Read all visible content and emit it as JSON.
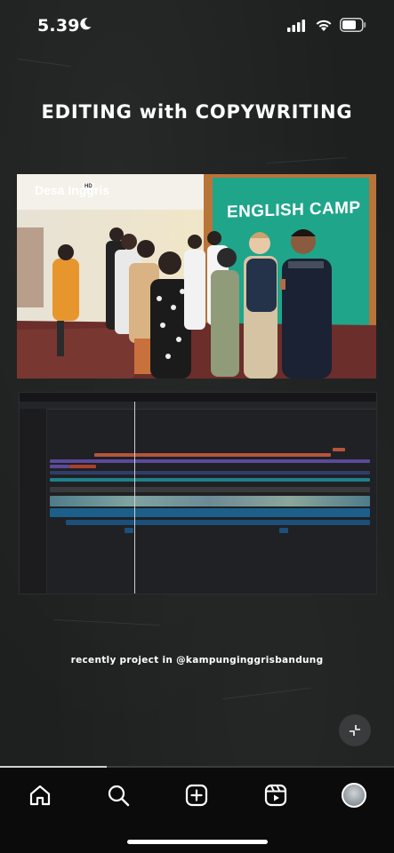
{
  "status_bar": {
    "time": "5.39"
  },
  "post": {
    "heading": "EDITING with COPYWRITING",
    "photo": {
      "logo_text": "Desa Inggris",
      "logo_badge": "HD",
      "banner_text": "ENGLISH CAMP"
    },
    "caption": "recently project in @kampunginggrisbandung"
  },
  "player": {
    "progress_fraction": 0.27
  },
  "nav": {
    "items": [
      "home-icon",
      "search-icon",
      "create-icon",
      "reels-icon",
      "profile-avatar"
    ]
  },
  "colors": {
    "background": "#1e2020",
    "nav_background": "#0b0b0b",
    "banner_green": "#1fa58a"
  }
}
